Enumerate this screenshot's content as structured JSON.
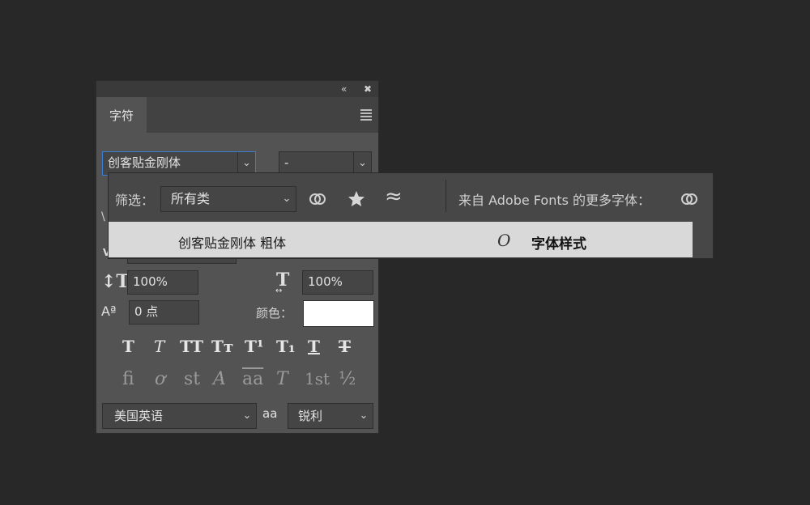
{
  "panel": {
    "tab_label": "字符",
    "collapse_icon": "double-chevron-left-icon",
    "close_icon": "close-icon",
    "menu_icon": "hamburger-menu-icon",
    "font_family": "创客贴金刚体",
    "font_style": "-",
    "leading_partial": "\\",
    "vertical_scale": "100%",
    "horizontal_scale": "100%",
    "baseline_shift": "0 点",
    "color_label": "颜色：",
    "color_value": "#ffffff",
    "style_buttons": [
      "T",
      "T",
      "TT",
      "Tт",
      "T¹",
      "T₁",
      "T",
      "T"
    ],
    "opentype_buttons": [
      "fi",
      "ơ",
      "st",
      "A",
      "aa",
      "T",
      "1st",
      "½"
    ],
    "language": "美国英语",
    "aa_icon": "aa",
    "antialias": "锐利"
  },
  "font_popup": {
    "filter_label": "筛选：",
    "filter_value": "所有类",
    "more_fonts_label": "来自 Adobe Fonts 的更多字体：",
    "results": [
      {
        "name": "创客贴金刚体 粗体",
        "type_icon": "O",
        "sample": "字体样式"
      }
    ]
  }
}
